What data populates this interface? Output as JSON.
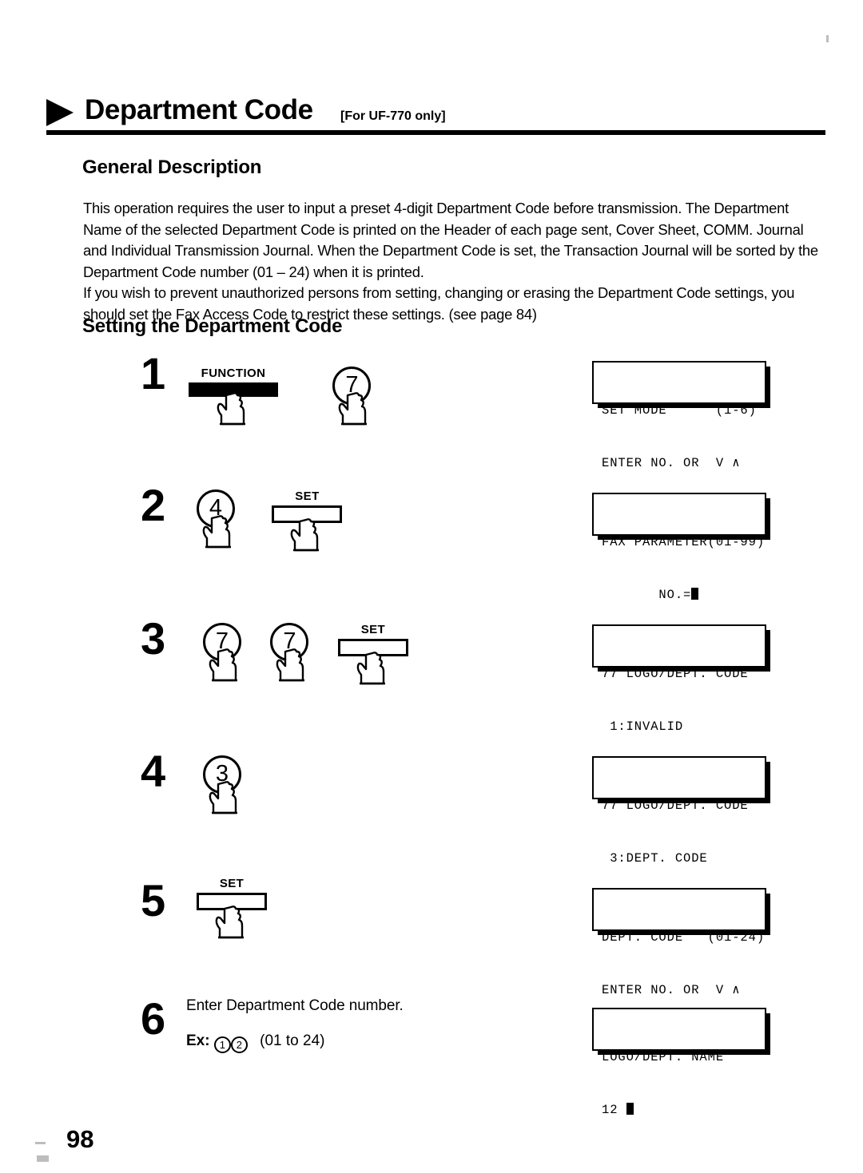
{
  "header": {
    "title": "Department Code",
    "subtitle": "[For UF-770 only]",
    "triangle_icon": "triangle-right-icon"
  },
  "sections": {
    "general_description_heading": "General Description",
    "setting_heading": "Setting the Department Code",
    "body_paragraph_1": "This operation requires the user to input a preset 4-digit Department Code before transmission. The Department Name of the selected Department Code is printed on the Header of each page sent, Cover Sheet, COMM. Journal and Individual Transmission Journal.  When the Department Code is set, the Transaction Journal will be sorted by the Department Code number (01 – 24) when it is printed.",
    "body_paragraph_2": "If you wish to prevent unauthorized persons from setting, changing or erasing the Department Code settings, you should set the Fax Access Code to restrict these settings.  (see page 84)"
  },
  "steps": [
    {
      "number": "1",
      "keys": [
        {
          "type": "bar",
          "label": "FUNCTION",
          "style": "filled"
        },
        {
          "type": "round",
          "label": "7"
        }
      ],
      "display": {
        "line1": "SET MODE      (1-6)",
        "line2": "ENTER NO. OR  V ∧",
        "cursor": false
      }
    },
    {
      "number": "2",
      "keys": [
        {
          "type": "round",
          "label": "4"
        },
        {
          "type": "bar",
          "label": "SET",
          "style": "outlined"
        }
      ],
      "display": {
        "line1": "FAX PARAMETER(01-99)",
        "line2": "       NO.=",
        "cursor": true
      }
    },
    {
      "number": "3",
      "keys": [
        {
          "type": "round",
          "label": "7"
        },
        {
          "type": "round",
          "label": "7"
        },
        {
          "type": "bar",
          "label": "SET",
          "style": "outlined"
        }
      ],
      "display": {
        "line1": "77 LOGO/DEPT. CODE",
        "line2": " 1:INVALID",
        "cursor": false
      }
    },
    {
      "number": "4",
      "keys": [
        {
          "type": "round",
          "label": "3"
        }
      ],
      "display": {
        "line1": "77 LOGO/DEPT. CODE",
        "line2": " 3:DEPT. CODE",
        "cursor": false
      }
    },
    {
      "number": "5",
      "keys": [
        {
          "type": "bar",
          "label": "SET",
          "style": "outlined"
        }
      ],
      "display": {
        "line1": "DEPT. CODE   (01-24)",
        "line2": "ENTER NO. OR  V ∧",
        "cursor": false
      }
    },
    {
      "number": "6",
      "instruction": "Enter Department Code number.",
      "example_prefix": "Ex:",
      "example_digit_1": "1",
      "example_digit_2": "2",
      "example_range": "(01 to 24)",
      "display": {
        "line1": "LOGO/DEPT. NAME",
        "line2": "12 ",
        "cursor": true
      }
    }
  ],
  "footer": {
    "page_number": "98"
  }
}
